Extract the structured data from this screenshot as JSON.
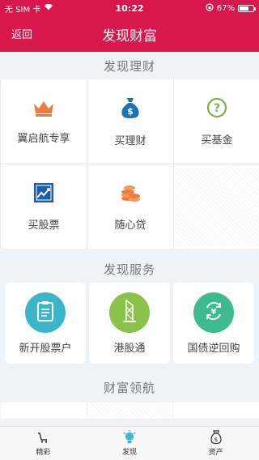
{
  "status": {
    "carrier": "无 SIM 卡",
    "time": "10:22",
    "battery": "67%",
    "battery_level": 0.67
  },
  "nav": {
    "back": "返回",
    "title": "发现财富"
  },
  "sections": {
    "finance": "发现理财",
    "services": "发现服务",
    "leaders": "财富领航"
  },
  "finance_items": [
    {
      "label": "翼启航专享",
      "icon": "crown-icon",
      "color": "#f07a3c"
    },
    {
      "label": "买理财",
      "icon": "money-bag-icon",
      "color": "#1a73b8"
    },
    {
      "label": "买基金",
      "icon": "question-circle-icon",
      "color": "#7cb342"
    },
    {
      "label": "买股票",
      "icon": "stock-chart-icon",
      "color": "#1e5ea8"
    },
    {
      "label": "随心贷",
      "icon": "coins-icon",
      "color": "#f07a3c"
    }
  ],
  "services": [
    {
      "label": "新开股票户",
      "icon": "clipboard-icon",
      "color": "#3bb6c8"
    },
    {
      "label": "港股通",
      "icon": "building-icon",
      "color": "#8bc34a"
    },
    {
      "label": "国债逆回购",
      "icon": "yen-cycle-icon",
      "color": "#3dbb8c"
    }
  ],
  "tabs": [
    {
      "label": "精彩",
      "icon": "cart-icon"
    },
    {
      "label": "发现",
      "icon": "lightbulb-icon"
    },
    {
      "label": "资产",
      "icon": "wallet-icon"
    }
  ]
}
